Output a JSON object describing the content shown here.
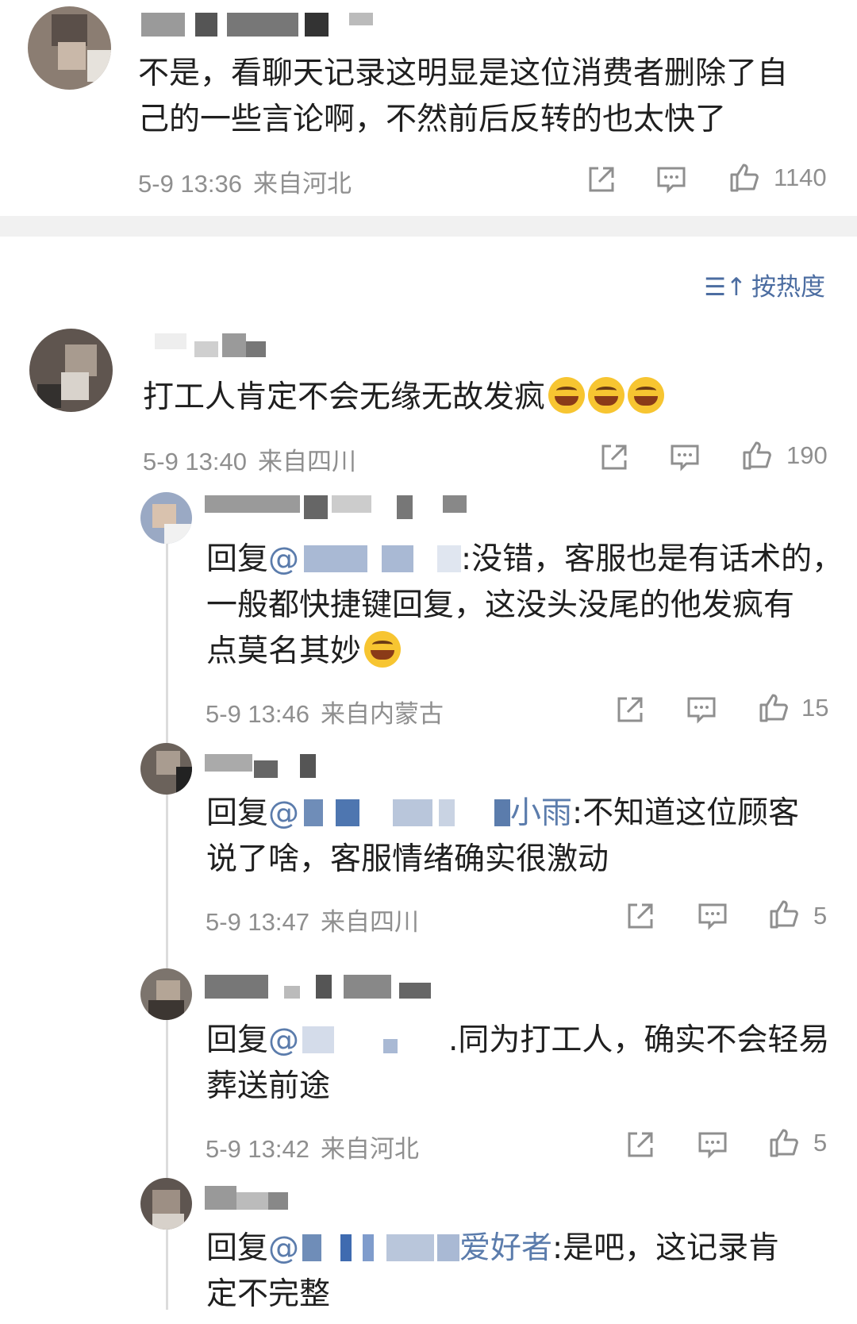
{
  "top_comment": {
    "text_lines": [
      "不是，看聊天记录这明显是这位消费者删除了自",
      "己的一些言论啊，不然前后反转的也太快了"
    ],
    "time": "5-9 13:36",
    "location": "来自河北",
    "likes": "1140"
  },
  "sort": {
    "label": "按热度",
    "icon": "sort-icon"
  },
  "comment2": {
    "text": "打工人肯定不会无缘无故发疯",
    "time": "5-9 13:40",
    "location": "来自四川",
    "likes": "190"
  },
  "replies": [
    {
      "reply_prefix": "回复",
      "mention": "@",
      "after_mask": ":没错，客服也是有话术的，",
      "line2": "一般都快捷键回复，这没头没尾的他发疯有",
      "line3": "点莫名其妙",
      "time": "5-9 13:46",
      "location": "来自内蒙古",
      "likes": "15"
    },
    {
      "reply_prefix": "回复",
      "mention": "@",
      "mention_tail": "小雨",
      "after_mask": ":不知道这位顾客",
      "line2": "说了啥，客服情绪确实很激动",
      "time": "5-9 13:47",
      "location": "来自四川",
      "likes": "5"
    },
    {
      "reply_prefix": "回复",
      "mention": "@",
      "after_mask": ".同为打工人，确实不会轻易",
      "line2": "葬送前途",
      "time": "5-9 13:42",
      "location": "来自河北",
      "likes": "5"
    },
    {
      "reply_prefix": "回复",
      "mention": "@",
      "mention_tail": "爱好者",
      "after_mask": ":是吧，这记录肯",
      "line2": "定不完整"
    }
  ],
  "icons": {
    "share": "share-icon",
    "comment": "comment-icon",
    "like": "like-icon"
  },
  "colors": {
    "mention": "#5b7cac",
    "meta": "#8f8f8f",
    "divider": "#f1f1f1"
  }
}
